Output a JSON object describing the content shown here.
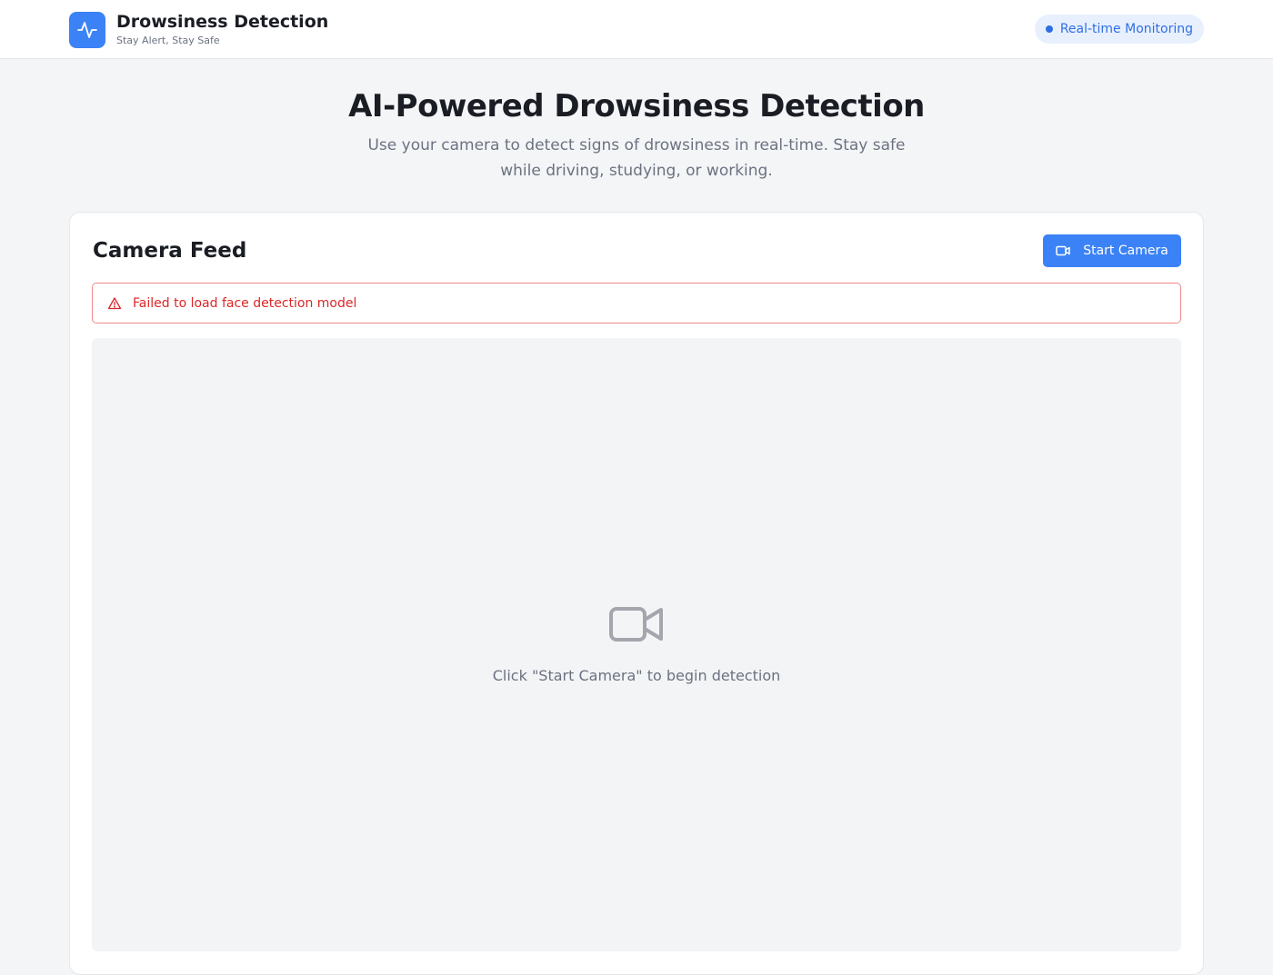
{
  "header": {
    "app_title": "Drowsiness Detection",
    "tagline": "Stay Alert, Stay Safe",
    "logo_icon": "activity-pulse-icon",
    "status_label": "Real-time Monitoring"
  },
  "hero": {
    "title": "AI-Powered Drowsiness Detection",
    "description": "Use your camera to detect signs of drowsiness in real-time. Stay safe while driving, studying, or working."
  },
  "camera_card": {
    "title": "Camera Feed",
    "start_button_label": "Start Camera",
    "start_button_icon": "video-camera-icon",
    "error_message": "Failed to load face detection model",
    "error_icon": "warning-triangle-icon",
    "placeholder_icon": "video-camera-icon",
    "placeholder_text": "Click \"Start Camera\" to begin detection"
  },
  "colors": {
    "accent": "#3b82f6",
    "error": "#dc2626",
    "status_text": "#2f6fe4",
    "status_bg": "#e8f0fe"
  }
}
